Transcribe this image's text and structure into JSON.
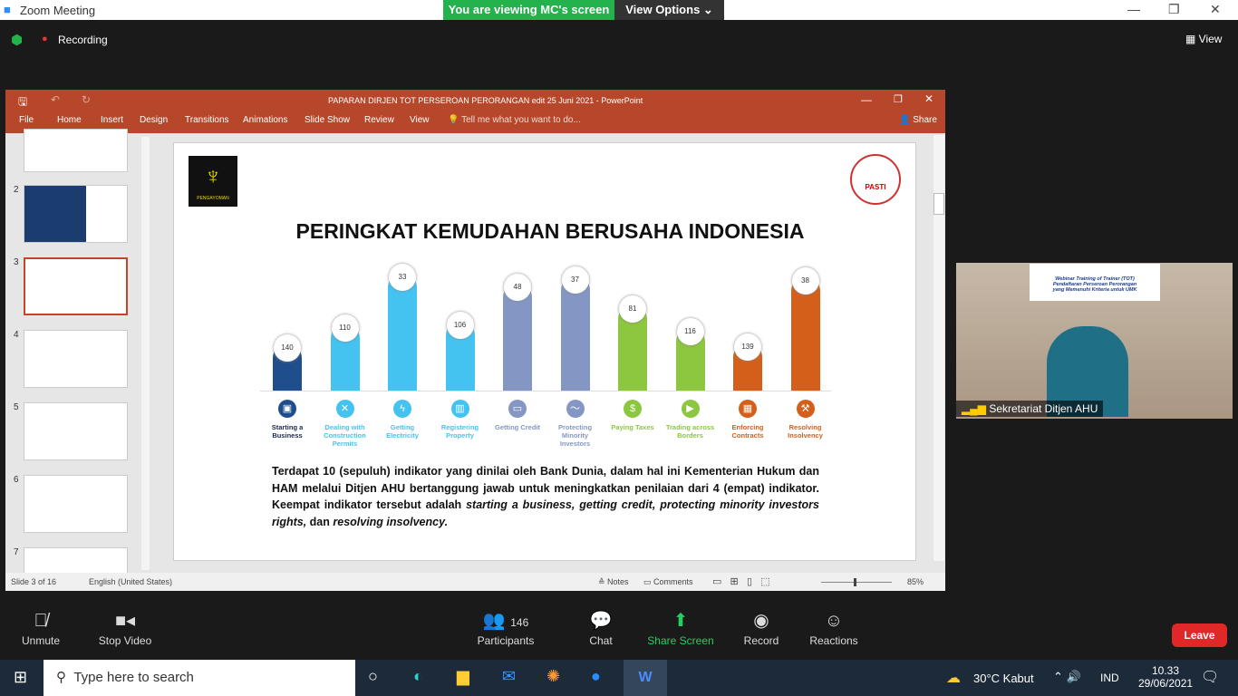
{
  "zoom": {
    "title": "Zoom Meeting",
    "viewing": "You are viewing MC's screen",
    "view_options": "View Options",
    "recording": "Recording",
    "view": "View"
  },
  "ppt": {
    "title": "PAPARAN DIRJEN TOT PERSEROAN PERORANGAN edit 25 Juni 2021 - PowerPoint",
    "tabs": [
      "File",
      "Home",
      "Insert",
      "Design",
      "Transitions",
      "Animations",
      "Slide Show",
      "Review",
      "View"
    ],
    "tell_me": "Tell me what you want to do...",
    "share": "Share",
    "thumb_numbers": [
      "2",
      "3",
      "4",
      "5",
      "6",
      "7"
    ],
    "status": {
      "slide": "Slide 3 of 16",
      "language": "English (United States)",
      "notes": "Notes",
      "comments": "Comments",
      "zoom": "85%"
    }
  },
  "slide": {
    "logo_text": "PENGAYOMAN",
    "pasti": "PASTI",
    "title": "PERINGKAT KEMUDAHAN BERUSAHA INDONESIA",
    "para_1": "Terdapat 10 (sepuluh) indikator yang dinilai oleh Bank Dunia, dalam hal ini Kementerian Hukum dan HAM melalui Ditjen AHU bertanggung jawab untuk meningkatkan penilaian dari 4 (empat) indikator. Keempat indikator tersebut adalah ",
    "para_italic": "starting a business, getting credit, protecting minority investors rights,",
    "para_2": " dan ",
    "para_italic2": "resolving insolvency."
  },
  "chart_data": {
    "type": "bar",
    "categories": [
      "Starting a Business",
      "Dealing with Construction Permits",
      "Getting Electricity",
      "Registering Property",
      "Getting Credit",
      "Protecting Minority Investors",
      "Paying Taxes",
      "Trading across Borders",
      "Enforcing Contracts",
      "Resolving Insolvency"
    ],
    "values": [
      140,
      110,
      33,
      106,
      48,
      37,
      81,
      116,
      139,
      38
    ],
    "colors": [
      "#1f4e8c",
      "#45c3f0",
      "#45c3f0",
      "#45c3f0",
      "#8497c4",
      "#8497c4",
      "#8dc63f",
      "#8dc63f",
      "#d35f1a",
      "#d35f1a"
    ],
    "icons": [
      "briefcase",
      "tools",
      "bolt",
      "building",
      "card",
      "trend",
      "money",
      "truck",
      "bank",
      "gavel"
    ],
    "title": "",
    "xlabel": "",
    "ylabel": ""
  },
  "video": {
    "banner_1": "Webinar Training of Trainer (TOT)",
    "banner_2": "Pendaftaran Perseroan Perorangan",
    "banner_3": "yang Memenuhi Kriteria untuk UMK",
    "name": "Sekretariat Ditjen AHU"
  },
  "controls": {
    "unmute": "Unmute",
    "stop_video": "Stop Video",
    "participants": "Participants",
    "participant_count": "146",
    "chat": "Chat",
    "share": "Share Screen",
    "record": "Record",
    "reactions": "Reactions",
    "leave": "Leave"
  },
  "taskbar": {
    "search": "Type here to search",
    "weather": "30°C  Kabut",
    "lang": "IND",
    "time": "10.33",
    "date": "29/06/2021"
  }
}
